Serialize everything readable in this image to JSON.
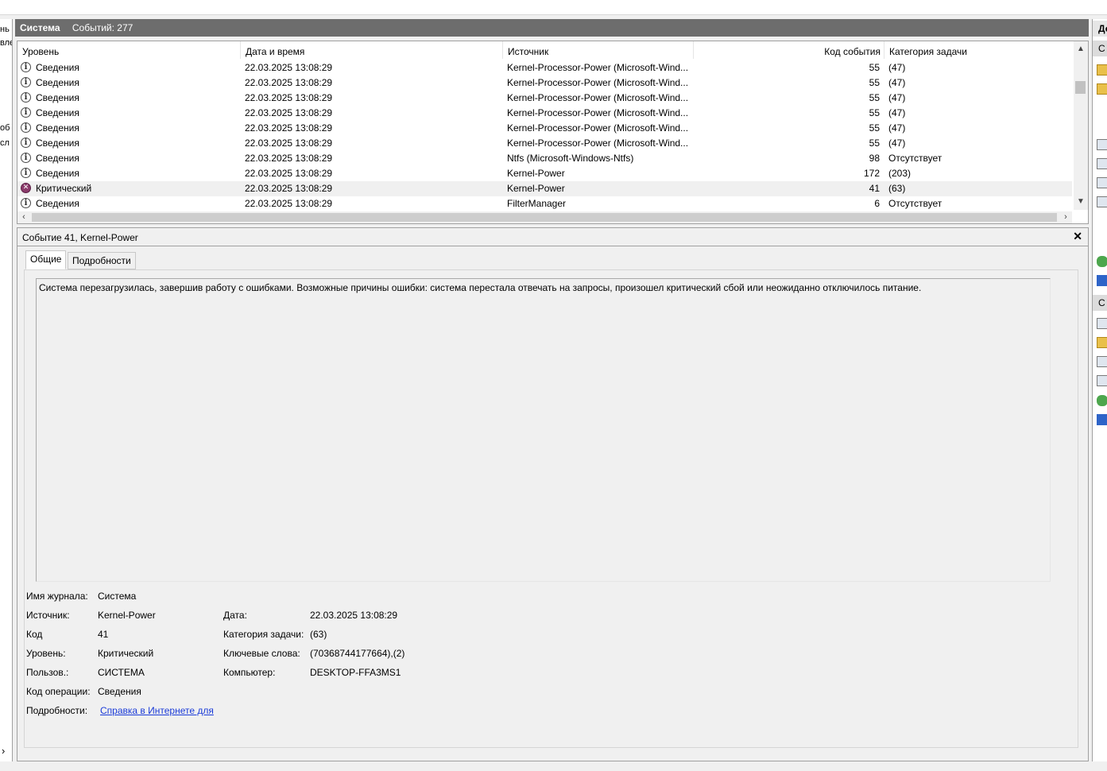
{
  "left_fragments": [
    "нь",
    "вле",
    "об",
    "сл"
  ],
  "header": {
    "title": "Система",
    "count": "Событий: 277"
  },
  "columns": {
    "level": "Уровень",
    "datetime": "Дата и время",
    "source": "Источник",
    "event_id": "Код события",
    "category": "Категория задачи"
  },
  "events": [
    {
      "level": "Сведения",
      "icon": "info-icon",
      "datetime": "22.03.2025 13:08:29",
      "source": "Kernel-Processor-Power (Microsoft-Wind...",
      "event_id": "55",
      "category": "(47)"
    },
    {
      "level": "Сведения",
      "icon": "info-icon",
      "datetime": "22.03.2025 13:08:29",
      "source": "Kernel-Processor-Power (Microsoft-Wind...",
      "event_id": "55",
      "category": "(47)"
    },
    {
      "level": "Сведения",
      "icon": "info-icon",
      "datetime": "22.03.2025 13:08:29",
      "source": "Kernel-Processor-Power (Microsoft-Wind...",
      "event_id": "55",
      "category": "(47)"
    },
    {
      "level": "Сведения",
      "icon": "info-icon",
      "datetime": "22.03.2025 13:08:29",
      "source": "Kernel-Processor-Power (Microsoft-Wind...",
      "event_id": "55",
      "category": "(47)"
    },
    {
      "level": "Сведения",
      "icon": "info-icon",
      "datetime": "22.03.2025 13:08:29",
      "source": "Kernel-Processor-Power (Microsoft-Wind...",
      "event_id": "55",
      "category": "(47)"
    },
    {
      "level": "Сведения",
      "icon": "info-icon",
      "datetime": "22.03.2025 13:08:29",
      "source": "Kernel-Processor-Power (Microsoft-Wind...",
      "event_id": "55",
      "category": "(47)"
    },
    {
      "level": "Сведения",
      "icon": "info-icon",
      "datetime": "22.03.2025 13:08:29",
      "source": "Ntfs (Microsoft-Windows-Ntfs)",
      "event_id": "98",
      "category": "Отсутствует"
    },
    {
      "level": "Сведения",
      "icon": "info-icon",
      "datetime": "22.03.2025 13:08:29",
      "source": "Kernel-Power",
      "event_id": "172",
      "category": "(203)"
    },
    {
      "level": "Критический",
      "icon": "critical-icon",
      "datetime": "22.03.2025 13:08:29",
      "source": "Kernel-Power",
      "event_id": "41",
      "category": "(63)",
      "selected": true
    },
    {
      "level": "Сведения",
      "icon": "info-icon",
      "datetime": "22.03.2025 13:08:29",
      "source": "FilterManager",
      "event_id": "6",
      "category": "Отсутствует"
    }
  ],
  "detail": {
    "title": "Событие 41, Kernel-Power",
    "close_glyph": "✕",
    "tabs": [
      "Общие",
      "Подробности"
    ],
    "description": "Система перезагрузилась, завершив работу с ошибками. Возможные причины ошибки: система перестала отвечать на запросы, произошел критический сбой или неожиданно отключилось питание.",
    "props": {
      "log_name_label": "Имя журнала:",
      "log_name": "Система",
      "source_label": "Источник:",
      "source": "Kernel-Power",
      "date_label": "Дата:",
      "date": "22.03.2025 13:08:29",
      "code_label": "Код",
      "code": "41",
      "category_label": "Категория задачи:",
      "category": "(63)",
      "level_label": "Уровень:",
      "level": "Критический",
      "keywords_label": "Ключевые слова:",
      "keywords": "(70368744177664),(2)",
      "user_label": "Пользов.:",
      "user": "СИСТЕМА",
      "computer_label": "Компьютер:",
      "computer": "DESKTOP-FFA3MS1",
      "opcode_label": "Код операции:",
      "opcode": "Сведения",
      "more_label": "Подробности:",
      "more_link": "Справка в Интернете для "
    }
  },
  "right_panel": {
    "header1": "Де",
    "header2": "С",
    "header3": "С"
  }
}
